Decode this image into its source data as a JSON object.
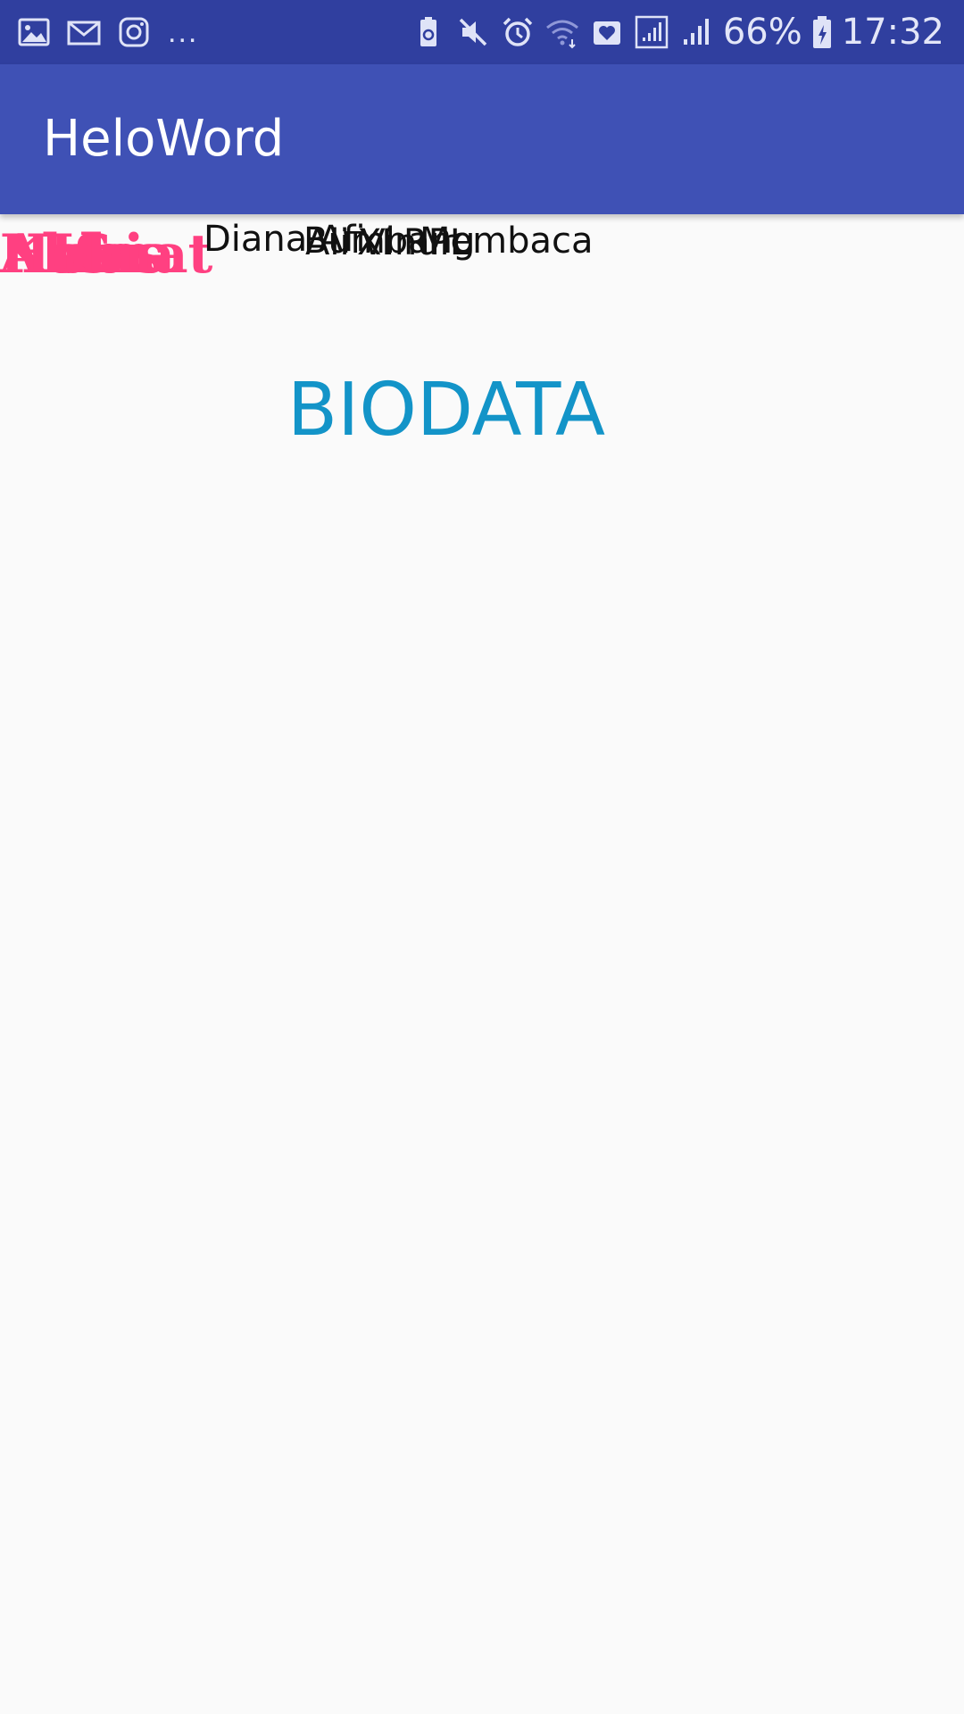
{
  "status_bar": {
    "left_icons": [
      "gallery-icon",
      "gmail-icon",
      "instagram-icon"
    ],
    "more": "...",
    "right_icons": [
      "battery-saver-icon",
      "mute-icon",
      "alarm-icon",
      "wifi-icon",
      "health-icon",
      "signal-box-icon",
      "signal-icon"
    ],
    "battery_percent": "66%",
    "time": "17:32"
  },
  "app_bar": {
    "title": "HeloWord"
  },
  "form": {
    "labels": [
      "Nama",
      "Kelas",
      "Alamat",
      "NIS",
      "Hobi"
    ],
    "values": [
      "Diana Afi",
      "Ali Vinur",
      "XI RPL",
      "Bumbang",
      "Membaca"
    ]
  },
  "heading": "BIODATA",
  "colors": {
    "status_bar": "#303f9f",
    "app_bar": "#3f51b5",
    "label": "#ff4081",
    "heading": "#1394c8",
    "background": "#fafafa"
  }
}
